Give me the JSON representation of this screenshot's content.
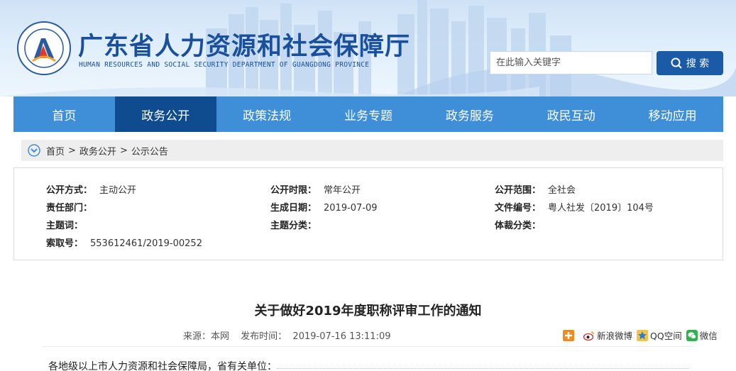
{
  "header": {
    "title": "广东省人力资源和社会保障厅",
    "subtitle": "HUMAN RESOURCES AND SOCIAL SECURITY DEPARTMENT OF GUANGDONG PROVINCE",
    "search_placeholder": "在此输入关键字",
    "search_label": "搜 索"
  },
  "nav": {
    "items": [
      "首页",
      "政务公开",
      "政策法规",
      "业务专题",
      "政务服务",
      "政民互动",
      "移动应用"
    ],
    "active_index": 1
  },
  "breadcrumb": {
    "items": [
      "首页",
      "政务公开",
      "公示公告"
    ],
    "separator": ">"
  },
  "meta": {
    "row1": [
      {
        "label": "公开方式：",
        "value": "主动公开"
      },
      {
        "label": "公开时限：",
        "value": "常年公开"
      },
      {
        "label": "公开范围：",
        "value": "全社会"
      }
    ],
    "row2": [
      {
        "label": "责任部门：",
        "value": ""
      },
      {
        "label": "生成日期：",
        "value": "2019-07-09"
      },
      {
        "label": "文件编号：",
        "value": "粤人社发〔2019〕104号"
      }
    ],
    "row3": [
      {
        "label": "主题词：",
        "value": ""
      },
      {
        "label": "主题分类：",
        "value": ""
      },
      {
        "label": "体裁分类：",
        "value": ""
      }
    ],
    "row4": [
      {
        "label": "索取号：",
        "value": "553612461/2019-00252"
      }
    ]
  },
  "article": {
    "title": "关于做好2019年度职称评审工作的通知",
    "source": "来源：本网",
    "publish_time": "发布时间：  2019-07-16 13:11:09",
    "salutation": "各地级以上市人力资源和社会保障局，省有关单位："
  },
  "share": {
    "items": [
      {
        "icon": "plus-icon",
        "label": ""
      },
      {
        "icon": "weibo-icon",
        "label": "新浪微博"
      },
      {
        "icon": "qzone-icon",
        "label": "QQ空间"
      },
      {
        "icon": "wechat-icon",
        "label": "微信"
      }
    ]
  },
  "colors": {
    "brand": "#1a4f9c",
    "nav": "#3f8fd8",
    "nav_active": "#0f4c8f",
    "search_button": "#1b5aa6"
  }
}
